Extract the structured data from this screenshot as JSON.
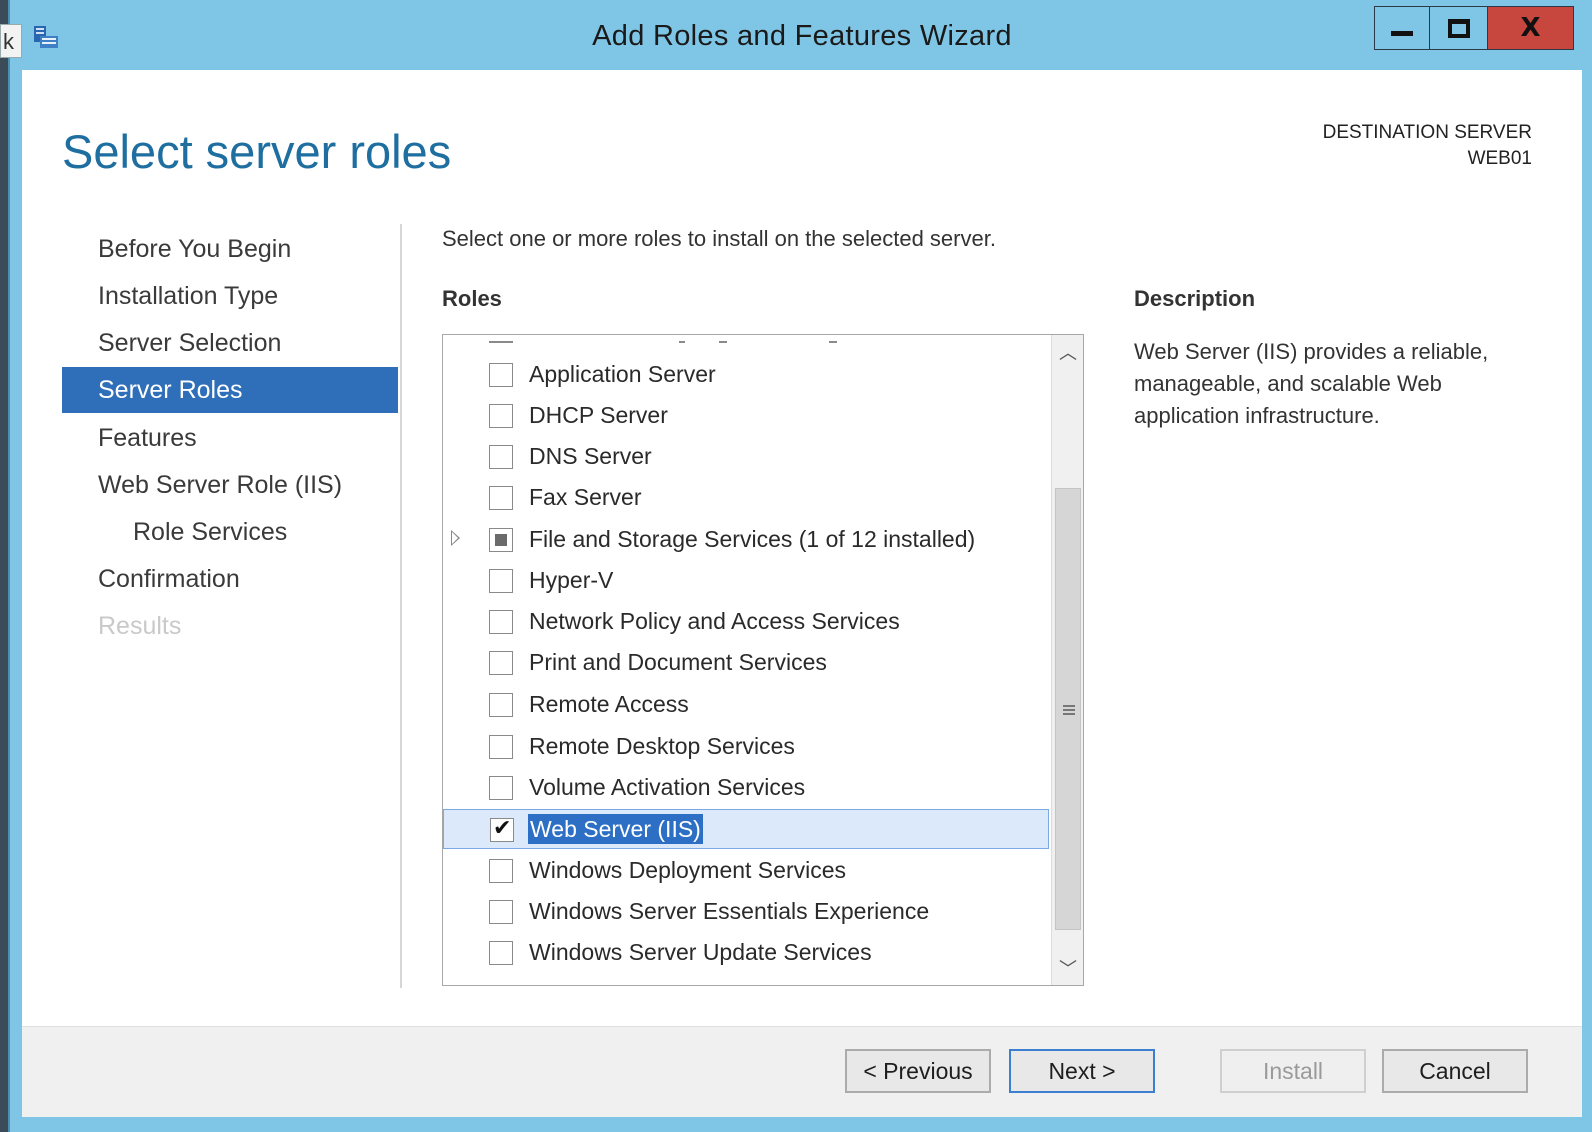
{
  "desktop": {
    "left_edge_text": "k"
  },
  "window": {
    "title": "Add Roles and Features Wizard",
    "controls": {
      "minimize_icon": "minimize-icon",
      "maximize_icon": "maximize-icon",
      "close_icon": "close-icon",
      "close_label": "X"
    }
  },
  "header": {
    "page_title": "Select server roles",
    "destination_label": "DESTINATION SERVER",
    "destination_server": "WEB01"
  },
  "nav": {
    "items": [
      {
        "label": "Before You Begin",
        "state": "normal"
      },
      {
        "label": "Installation Type",
        "state": "normal"
      },
      {
        "label": "Server Selection",
        "state": "normal"
      },
      {
        "label": "Server Roles",
        "state": "active"
      },
      {
        "label": "Features",
        "state": "normal"
      },
      {
        "label": "Web Server Role (IIS)",
        "state": "normal"
      },
      {
        "label": "Role Services",
        "state": "sub"
      },
      {
        "label": "Confirmation",
        "state": "normal"
      },
      {
        "label": "Results",
        "state": "disabled"
      }
    ]
  },
  "main": {
    "instruction": "Select one or more roles to install on the selected server.",
    "roles_heading": "Roles",
    "roles": [
      {
        "label": "Application Server",
        "state": "unchecked"
      },
      {
        "label": "DHCP Server",
        "state": "unchecked"
      },
      {
        "label": "DNS Server",
        "state": "unchecked"
      },
      {
        "label": "Fax Server",
        "state": "unchecked"
      },
      {
        "label": "File and Storage Services (1 of 12 installed)",
        "state": "partial",
        "expandable": true
      },
      {
        "label": "Hyper-V",
        "state": "unchecked"
      },
      {
        "label": "Network Policy and Access Services",
        "state": "unchecked"
      },
      {
        "label": "Print and Document Services",
        "state": "unchecked"
      },
      {
        "label": "Remote Access",
        "state": "unchecked"
      },
      {
        "label": "Remote Desktop Services",
        "state": "unchecked"
      },
      {
        "label": "Volume Activation Services",
        "state": "unchecked"
      },
      {
        "label": "Web Server (IIS)",
        "state": "checked",
        "selected": true
      },
      {
        "label": "Windows Deployment Services",
        "state": "unchecked"
      },
      {
        "label": "Windows Server Essentials Experience",
        "state": "unchecked"
      },
      {
        "label": "Windows Server Update Services",
        "state": "unchecked"
      }
    ],
    "scroll_position": 0.85
  },
  "description": {
    "heading": "Description",
    "text": "Web Server (IIS) provides a reliable, manageable, and scalable Web application infrastructure."
  },
  "footer": {
    "previous_label": "< Previous",
    "next_label": "Next >",
    "install_label": "Install",
    "cancel_label": "Cancel"
  },
  "colors": {
    "titlebar": "#7fc6e6",
    "accent": "#2f6eb8",
    "close": "#c7463d",
    "title_text": "#1e6ea0"
  }
}
